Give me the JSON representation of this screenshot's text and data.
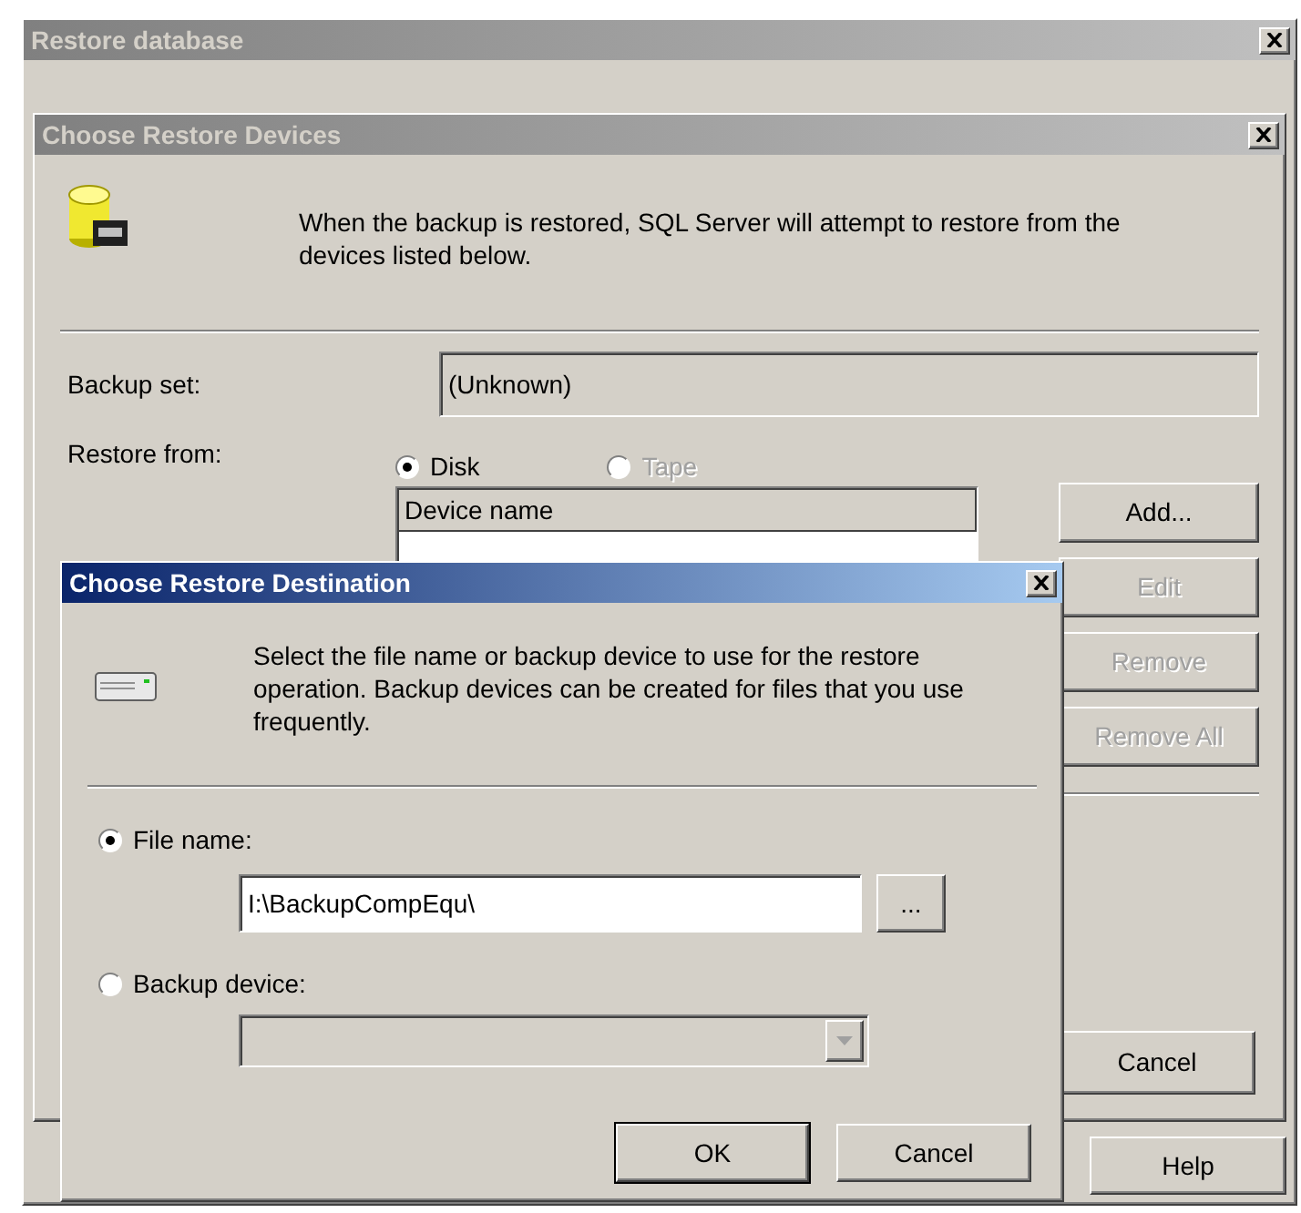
{
  "main_window": {
    "title": "Restore database",
    "help_button": "Help"
  },
  "devices_dialog": {
    "title": "Choose Restore Devices",
    "message": "When the backup is restored, SQL Server will attempt to restore from the devices listed below.",
    "backup_set_label": "Backup set:",
    "backup_set_value": "(Unknown)",
    "restore_from_label": "Restore from:",
    "sources": [
      {
        "label": "Disk",
        "selected": true,
        "disabled": false
      },
      {
        "label": "Tape",
        "selected": false,
        "disabled": true
      }
    ],
    "device_list_header": "Device name",
    "buttons": [
      {
        "label": "Add...",
        "disabled": false
      },
      {
        "label": "Edit",
        "disabled": true
      },
      {
        "label": "Remove",
        "disabled": true
      },
      {
        "label": "Remove All",
        "disabled": true
      }
    ],
    "cancel_button": "Cancel"
  },
  "destination_dialog": {
    "title": "Choose Restore Destination",
    "message": "Select the file name or backup device to use for the restore operation.  Backup devices can be created for files that you use frequently.",
    "options": [
      {
        "label": "File name:",
        "selected": true
      },
      {
        "label": "Backup device:",
        "selected": false
      }
    ],
    "file_name_value": "I:\\BackupCompEqu\\",
    "browse_button": "...",
    "ok_button": "OK",
    "cancel_button": "Cancel"
  }
}
